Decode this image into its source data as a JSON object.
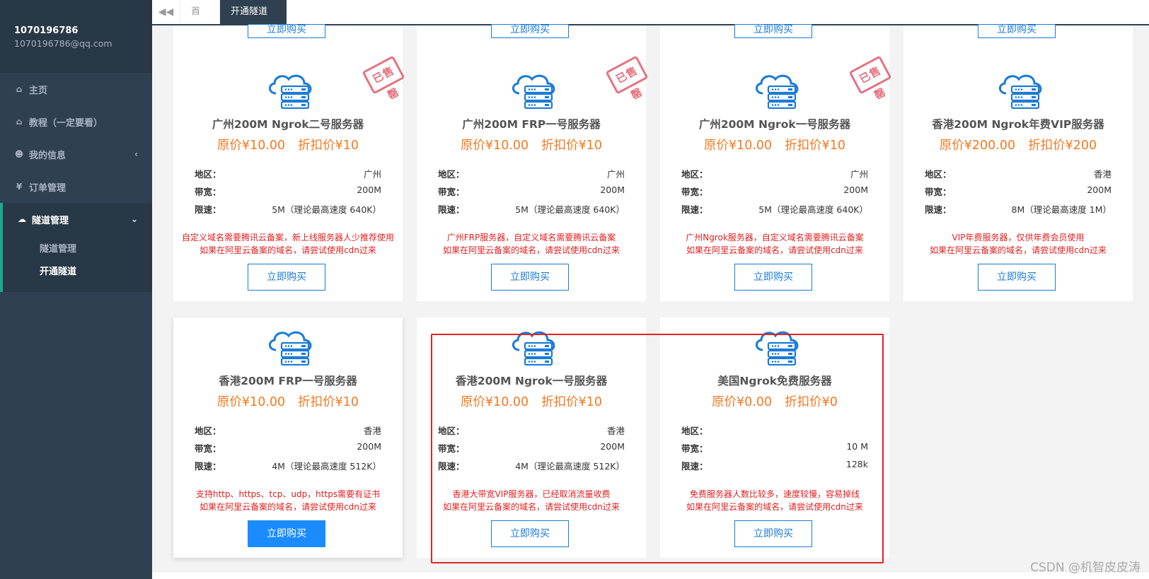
{
  "profile": {
    "username": "1070196786",
    "email": "1070196786@qq.com"
  },
  "sidebar": {
    "items": [
      {
        "label": "主页",
        "icon": "home-icon"
      },
      {
        "label": "教程（一定要看）",
        "icon": "home-icon"
      },
      {
        "label": "我的信息",
        "icon": "user-icon"
      },
      {
        "label": "订单管理",
        "icon": "yen-icon"
      },
      {
        "label": "隧道管理",
        "icon": "cloud-icon"
      }
    ],
    "subitems": [
      {
        "label": "隧道管理"
      },
      {
        "label": "开通隧道"
      }
    ]
  },
  "tabs": {
    "home": "首页",
    "current": "开通隧道"
  },
  "top_row_buy_label": "立即购买",
  "cards": [
    {
      "title": "广州200M Ngrok二号服务器",
      "original_price": "原价¥10.00",
      "discount_price": "折扣价¥10",
      "region_label": "地区：",
      "region": "广州",
      "bandwidth_label": "带宽：",
      "bandwidth": "200M",
      "speed_label": "限速：",
      "speed": "5M（理论最高速度 640K）",
      "note1": "自定义域名需要腾讯云备案，新上线服务器人少推荐使用",
      "note2": "如果在阿里云备案的域名，请尝试使用cdn过来",
      "buy_label": "立即购买",
      "sold_out": "已售罄"
    },
    {
      "title": "广州200M FRP一号服务器",
      "original_price": "原价¥10.00",
      "discount_price": "折扣价¥10",
      "region_label": "地区：",
      "region": "广州",
      "bandwidth_label": "带宽：",
      "bandwidth": "200M",
      "speed_label": "限速：",
      "speed": "5M（理论最高速度 640K）",
      "note1": "广州FRP服务器，自定义域名需要腾讯云备案",
      "note2": "如果在阿里云备案的域名，请尝试使用cdn过来",
      "buy_label": "立即购买",
      "sold_out": "已售罄"
    },
    {
      "title": "广州200M Ngrok一号服务器",
      "original_price": "原价¥10.00",
      "discount_price": "折扣价¥10",
      "region_label": "地区：",
      "region": "广州",
      "bandwidth_label": "带宽：",
      "bandwidth": "200M",
      "speed_label": "限速：",
      "speed": "5M（理论最高速度 640K）",
      "note1": "广州Ngrok服务器，自定义域名需要腾讯云备案",
      "note2": "如果在阿里云备案的域名，请尝试使用cdn过来",
      "buy_label": "立即购买",
      "sold_out": "已售罄"
    },
    {
      "title": "香港200M Ngrok年费VIP服务器",
      "original_price": "原价¥200.00",
      "discount_price": "折扣价¥200",
      "region_label": "地区：",
      "region": "香港",
      "bandwidth_label": "带宽：",
      "bandwidth": "200M",
      "speed_label": "限速：",
      "speed": "8M（理论最高速度 1M）",
      "note1": "VIP年费服务器，仅供年费会员使用",
      "note2": "如果在阿里云备案的域名，请尝试使用cdn过来",
      "buy_label": "立即购买"
    },
    {
      "title": "香港200M FRP一号服务器",
      "original_price": "原价¥10.00",
      "discount_price": "折扣价¥10",
      "region_label": "地区：",
      "region": "香港",
      "bandwidth_label": "带宽：",
      "bandwidth": "200M",
      "speed_label": "限速：",
      "speed": "4M（理论最高速度 512K）",
      "note1": "支持http、https、tcp、udp，https需要有证书",
      "note2": "如果在阿里云备案的域名，请尝试使用cdn过来",
      "buy_label": "立即购买"
    },
    {
      "title": "香港200M Ngrok一号服务器",
      "original_price": "原价¥10.00",
      "discount_price": "折扣价¥10",
      "region_label": "地区：",
      "region": "香港",
      "bandwidth_label": "带宽：",
      "bandwidth": "200M",
      "speed_label": "限速：",
      "speed": "4M（理论最高速度 512K）",
      "note1": "香港大带宽VIP服务器，已经取消流量收费",
      "note2": "如果在阿里云备案的域名，请尝试使用cdn过来",
      "buy_label": "立即购买"
    },
    {
      "title": "美国Ngrok免费服务器",
      "original_price": "原价¥0.00",
      "discount_price": "折扣价¥0",
      "region_label": "地区：",
      "region": "",
      "bandwidth_label": "带宽：",
      "bandwidth": "10 M",
      "speed_label": "限速：",
      "speed": "128k",
      "note1": "免费服务器人数比较多，速度较慢，容易掉线",
      "note2": "如果在阿里云备案的域名，请尝试使用cdn过来",
      "buy_label": "立即购买"
    }
  ],
  "watermark": "CSDN @机智皮皮涛",
  "colors": {
    "sidebar": "#2f4050",
    "price": "#f47920",
    "note": "#e02020",
    "button": "#1a7bd6",
    "highlight": "#e02424"
  }
}
